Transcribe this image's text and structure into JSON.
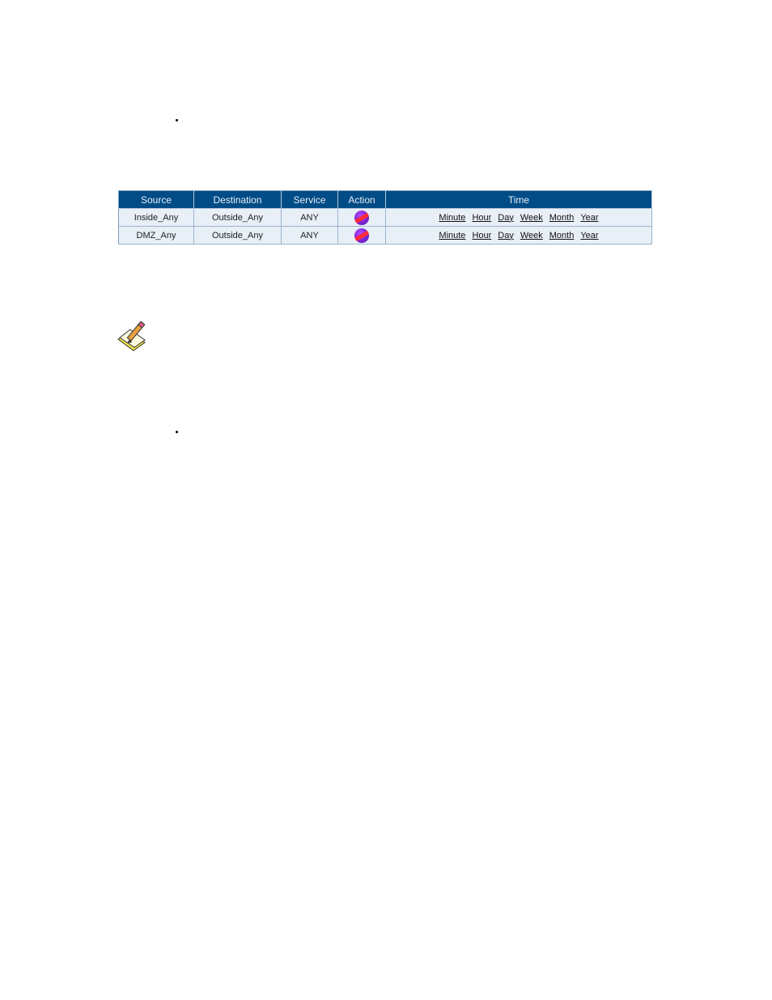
{
  "table": {
    "headers": {
      "source": "Source",
      "destination": "Destination",
      "service": "Service",
      "action": "Action",
      "time": "Time"
    },
    "rows": [
      {
        "source": "Inside_Any",
        "destination": "Outside_Any",
        "service": "ANY",
        "action_icon": "deny-icon",
        "time_links": [
          "Minute",
          "Hour",
          "Day",
          "Week",
          "Month",
          "Year"
        ]
      },
      {
        "source": "DMZ_Any",
        "destination": "Outside_Any",
        "service": "ANY",
        "action_icon": "deny-icon",
        "time_links": [
          "Minute",
          "Hour",
          "Day",
          "Week",
          "Month",
          "Year"
        ]
      }
    ]
  },
  "note": {
    "icon": "note-pencil-icon"
  },
  "colors": {
    "header_bg": "#004c86",
    "row_bg": "#e8eff7",
    "border": "#7f9db9"
  }
}
